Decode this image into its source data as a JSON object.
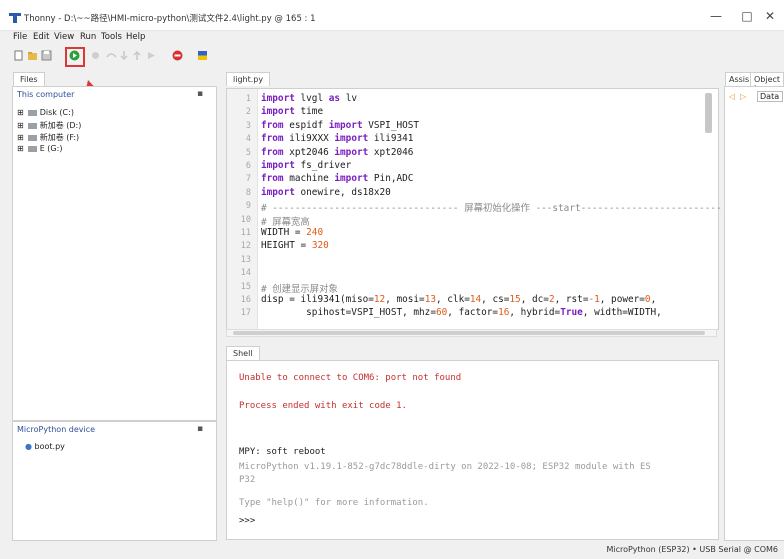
{
  "window": {
    "title": "Thonny  -  D:\\~~路径\\HMI-micro-python\\测试文件2.4\\light.py  @  165 : 1",
    "controls": [
      "—",
      "□",
      "✕"
    ]
  },
  "menu": [
    "File",
    "Edit",
    "View",
    "Run",
    "Tools",
    "Help"
  ],
  "toolbar": {
    "icons": [
      "new-file-icon",
      "open-folder-icon",
      "save-icon",
      "run-icon",
      "debug-icon",
      "step-over-icon",
      "step-into-icon",
      "step-out-icon",
      "resume-icon",
      "stop-icon",
      "flag-icon"
    ],
    "highlighted": "run-icon",
    "colors": {
      "run": "#2e9e3a",
      "stop": "#d93030",
      "highlight": "#d83a3a"
    }
  },
  "files_panel": {
    "tab": "Files",
    "header": "This computer",
    "items": [
      "Disk (C:)",
      "新加卷 (D:)",
      "新加卷 (F:)",
      "E (G:)"
    ]
  },
  "device_panel": {
    "header": "MicroPython device",
    "items": [
      "boot.py"
    ]
  },
  "editor": {
    "tab": "light.py",
    "lines": [
      {
        "n": "1",
        "html": "<span class=\"kw\">import</span> lvgl <span class=\"kw\">as</span> lv"
      },
      {
        "n": "2",
        "html": "<span class=\"kw\">import</span> time"
      },
      {
        "n": "3",
        "html": "<span class=\"kw\">from</span> espidf <span class=\"kw\">import</span> VSPI_HOST"
      },
      {
        "n": "4",
        "html": "<span class=\"kw\">from</span> ili9XXX <span class=\"kw\">import</span> ili9341"
      },
      {
        "n": "5",
        "html": "<span class=\"kw\">from</span> xpt2046 <span class=\"kw\">import</span> xpt2046"
      },
      {
        "n": "6",
        "html": "<span class=\"kw\">import</span> fs_driver"
      },
      {
        "n": "7",
        "html": "<span class=\"kw\">from</span> machine <span class=\"kw\">import</span> Pin,ADC"
      },
      {
        "n": "8",
        "html": "<span class=\"kw\">import</span> onewire, ds18x20"
      },
      {
        "n": "9",
        "html": "<span class=\"com\"># --------------------------------- 屏幕初始化操作 ---start-------------------------</span>"
      },
      {
        "n": "10",
        "html": "<span class=\"com\"># 屏幕宽高</span>"
      },
      {
        "n": "11",
        "html": "WIDTH = <span class=\"num\">240</span>"
      },
      {
        "n": "12",
        "html": "HEIGHT = <span class=\"num\">320</span>"
      },
      {
        "n": "13",
        "html": ""
      },
      {
        "n": "14",
        "html": ""
      },
      {
        "n": "15",
        "html": "<span class=\"com\"># 创建显示屏对象</span>"
      },
      {
        "n": "16",
        "html": "disp = ili9341(miso=<span class=\"num\">12</span>, mosi=<span class=\"num\">13</span>, clk=<span class=\"num\">14</span>, cs=<span class=\"num\">15</span>, dc=<span class=\"num\">2</span>, rst=<span class=\"num\">-1</span>, power=<span class=\"num\">0</span>,"
      },
      {
        "n": "17",
        "html": "        spihost=VSPI_HOST, mhz=<span class=\"num\">60</span>, factor=<span class=\"num\">16</span>, hybrid=<span class=\"kw\">True</span>, width=WIDTH,"
      }
    ]
  },
  "shell": {
    "tab": "Shell",
    "lines": [
      {
        "cls": "err",
        "text": "Unable to connect to COM6: port not found"
      },
      {
        "cls": "err",
        "text": "Process ended with exit code 1."
      },
      {
        "cls": "",
        "text": "MPY: soft reboot"
      },
      {
        "cls": "dim",
        "text": "MicroPython v1.19.1-852-g7dc78ddle-dirty on 2022-10-08; ESP32 module with ES"
      },
      {
        "cls": "dim",
        "text": "P32"
      },
      {
        "cls": "dim",
        "text": "Type \"help()\" for more information."
      },
      {
        "cls": "",
        "text": ">>>"
      }
    ]
  },
  "assist_panel": {
    "tabs": [
      "Assis",
      "Object i"
    ],
    "nav": [
      "◁",
      "▷"
    ],
    "field": "Data"
  },
  "status": "MicroPython (ESP32)  •  USB Serial @ COM6"
}
